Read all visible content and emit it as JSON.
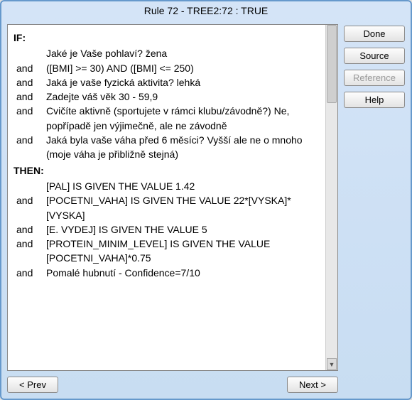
{
  "title": "Rule 72 - TREE2:72 : TRUE",
  "rule": {
    "if_label": "IF:",
    "then_label": "THEN:",
    "and_label": "and",
    "conditions": [
      "Jaké je Vaše pohlaví? žena",
      "([BMI] >= 30) AND ([BMI] <= 250)",
      "Jaká je vaše fyzická aktivita? lehká",
      "Zadejte váš věk 30 - 59,9",
      "Cvičíte aktivně (sportujete v rámci klubu/závodně?) Ne, popřípadě jen výjimečně, ale ne závodně",
      "Jaká byla vaše váha před 6 měsíci? Vyšší ale ne o mnoho (moje váha je přibližně stejná)"
    ],
    "actions": [
      "[PAL] IS GIVEN THE VALUE 1.42",
      "[POCETNI_VAHA] IS GIVEN THE VALUE 22*[VYSKA]*[VYSKA]",
      "[E. VYDEJ] IS GIVEN THE VALUE 5",
      "[PROTEIN_MINIM_LEVEL] IS GIVEN THE VALUE [POCETNI_VAHA]*0.75",
      "Pomalé hubnutí - Confidence=7/10"
    ]
  },
  "nav": {
    "prev": "< Prev",
    "next": "Next >"
  },
  "side": {
    "done": "Done",
    "source": "Source",
    "reference": "Reference",
    "help": "Help"
  }
}
